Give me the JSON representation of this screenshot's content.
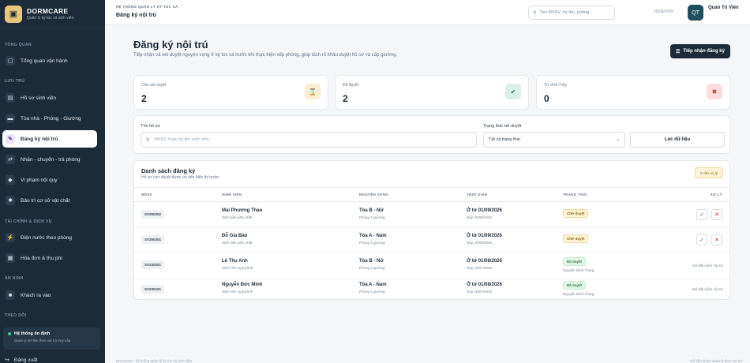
{
  "brand": {
    "name": "DORMCARE",
    "sub": "Quản lý ký túc xá sinh viên",
    "logo_icon": "building-icon"
  },
  "sidebar": {
    "sections": [
      "TỔNG QUAN",
      "LƯU TRÚ",
      "TÀI CHÍNH & DỊCH VỤ",
      "AN NINH",
      "THEO DÕI"
    ],
    "items": [
      {
        "label": "Tổng quan vận hành",
        "icon": "dashboard-icon"
      },
      {
        "label": "Hồ sơ sinh viên",
        "icon": "id-card-icon"
      },
      {
        "label": "Tòa nhà - Phòng - Giường",
        "icon": "bed-icon"
      },
      {
        "label": "Đăng ký nội trú",
        "icon": "form-icon",
        "active": true
      },
      {
        "label": "Nhận - chuyển - trả phòng",
        "icon": "swap-icon"
      },
      {
        "label": "Vi phạm nội quy",
        "icon": "shield-icon"
      },
      {
        "label": "Bảo trì cơ sở vật chất",
        "icon": "tools-icon"
      },
      {
        "label": "Điện nước theo phòng",
        "icon": "bolt-icon"
      },
      {
        "label": "Hóa đơn & thu phí",
        "icon": "invoice-icon"
      },
      {
        "label": "Khách ra vào",
        "icon": "visitor-icon"
      }
    ],
    "status": {
      "title": "Hệ thống ổn định",
      "sub": "Quản lý dữ liệu theo vai trò truy cập"
    },
    "logout": "Đăng xuất"
  },
  "topbar": {
    "system": "HỆ THỐNG QUẢN LÝ KÝ TÚC XÁ",
    "page": "Đăng ký nội trú",
    "search_placeholder": "Tìm MSSV, họ tên, phòng...",
    "date": "20/08/2026",
    "avatar": "QT",
    "user": "Quản Trị Viên"
  },
  "main": {
    "title": "Đăng ký nội trú",
    "subtitle": "Tiếp nhận và xét duyệt nguyện vọng ở ký túc xá trước khi thực hiện xếp phòng, giúp tách rõ khâu duyệt hồ sơ và cấp giường.",
    "primary_button": "Tiếp nhận đăng ký"
  },
  "stats": [
    {
      "label": "Chờ xét duyệt",
      "value": "2",
      "icon": "hourglass-icon",
      "color": "#fbeed0"
    },
    {
      "label": "Đã duyệt",
      "value": "2",
      "icon": "check-circle-icon",
      "color": "#dcefe8"
    },
    {
      "label": "Từ chối / hủy",
      "value": "0",
      "icon": "x-circle-icon",
      "color": "#fbdde0"
    }
  ],
  "filters": {
    "search_label": "Tìm hồ sơ",
    "search_placeholder": "MSSV hoặc họ tên sinh viên...",
    "status_label": "Trạng thái xét duyệt",
    "status_value": "Tất cả trạng thái",
    "filter_button": "Lọc dữ liệu"
  },
  "list": {
    "title": "Danh sách đăng ký",
    "subtitle": "Hồ sơ chờ duyệt được ưu tiên hiển thị trước",
    "badge": "2 cần xử lý",
    "columns": [
      "MSSV",
      "SINH VIÊN",
      "NGUYỆN VỌNG",
      "THỜI GIAN",
      "TRẠNG THÁI",
      "XỬ LÝ"
    ],
    "rows": [
      {
        "code": "SV250302",
        "name": "Mai Phương Thảo",
        "type": "Sinh viên năm nhất",
        "wish": "Tòa B - Nữ",
        "room": "Phòng 4 giường",
        "from": "Ở từ 01/09/2026",
        "submitted": "Nộp 20/08/2026",
        "status": "Chờ duyệt",
        "status_kind": "pending",
        "handler": "",
        "note": ""
      },
      {
        "code": "SV250301",
        "name": "Đỗ Gia Bảo",
        "type": "Sinh viên năm nhất",
        "wish": "Tòa A - Nam",
        "room": "Phòng 4 giường",
        "from": "Ở từ 01/09/2026",
        "submitted": "Nộp 20/08/2026",
        "status": "Chờ duyệt",
        "status_kind": "pending",
        "handler": "",
        "note": ""
      },
      {
        "code": "SV230201",
        "name": "Lê Thu Anh",
        "type": "Sinh viên ngoại tỉnh",
        "wish": "Tòa B - Nữ",
        "room": "Phòng 4 giường",
        "from": "Ở từ 01/08/2026",
        "submitted": "Nộp 18/07/2026",
        "status": "Đã duyệt",
        "status_kind": "ok",
        "handler": "Nguyễn Minh Trang",
        "note": "Đã điều kiện nội trú"
      },
      {
        "code": "SV230101",
        "name": "Nguyễn Đức Minh",
        "type": "Sinh viên ngoại tỉnh",
        "wish": "Tòa A - Nam",
        "room": "Phòng 4 giường",
        "from": "Ở từ 01/08/2026",
        "submitted": "Nộp 15/07/2026",
        "status": "Đã duyệt",
        "status_kind": "ok",
        "handler": "Nguyễn Minh Trang",
        "note": "Đã điều kiện nội trú"
      }
    ]
  },
  "footer": {
    "left": "DormCare - hệ thống quản lý ký túc xá sinh viên",
    "right": "Dữ liệu được quản lý theo vai trò"
  }
}
